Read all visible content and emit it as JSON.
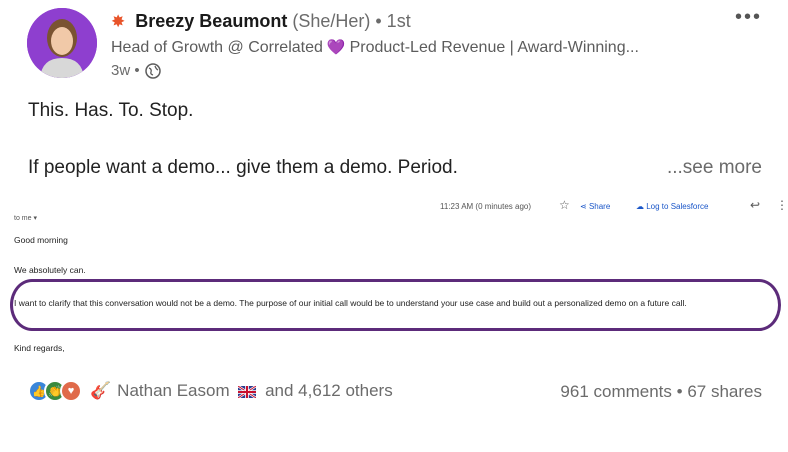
{
  "post": {
    "author": {
      "name": "Breezy Beaumont",
      "pronouns": "(She/Her)",
      "degree": "• 1st",
      "headline_part1": "Head of Growth @ Correlated",
      "headline_part2": "Product-Led Revenue | Award-Winning...",
      "time": "3w •"
    },
    "more_options": "•••",
    "text_line1": "This. Has. To. Stop.",
    "text_line2": "If people want a demo... give them a demo. Period.",
    "see_more": "...see more"
  },
  "email": {
    "timestamp": "11:23 AM (0 minutes ago)",
    "share_label": "Share",
    "salesforce_label": "Log to Salesforce",
    "to_me": "to me ▾",
    "greeting": "Good morning",
    "line_can": "We absolutely can.",
    "clarify": "I want to clarify that this conversation would not be a demo. The purpose of our initial call would be to understand your use case and build out a personalized demo on a future call.",
    "regards": "Kind regards,"
  },
  "footer": {
    "reactor_name": "Nathan Easom",
    "others": "and 4,612 others",
    "comments": "961 comments",
    "separator": "•",
    "shares": "67 shares"
  },
  "colors": {
    "accent_purple": "#5c2b7a",
    "link_blue": "#1a56c8",
    "avatar_bg": "#8e3fcf"
  },
  "icons": [
    "sparkle-icon",
    "purple-heart-icon",
    "globe-icon",
    "star-icon",
    "share-icon",
    "salesforce-icon",
    "reply-icon",
    "like-reaction-icon",
    "celebrate-reaction-icon",
    "love-reaction-icon",
    "guitar-icon",
    "uk-flag-icon"
  ]
}
